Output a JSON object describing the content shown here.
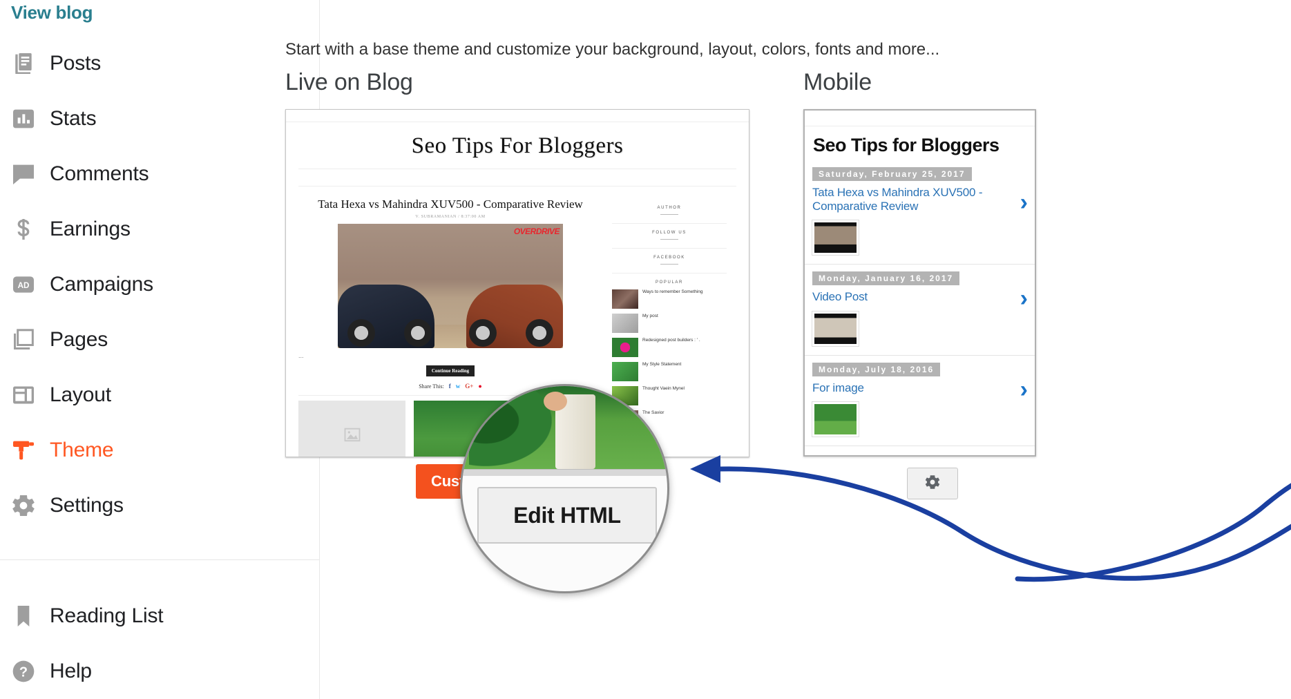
{
  "sidebar": {
    "view_blog": "View blog",
    "main_items": [
      {
        "label": "Posts",
        "icon": "posts-icon"
      },
      {
        "label": "Stats",
        "icon": "stats-icon"
      },
      {
        "label": "Comments",
        "icon": "comments-icon"
      },
      {
        "label": "Earnings",
        "icon": "earnings-icon"
      },
      {
        "label": "Campaigns",
        "icon": "campaigns-icon"
      },
      {
        "label": "Pages",
        "icon": "pages-icon"
      },
      {
        "label": "Layout",
        "icon": "layout-icon"
      },
      {
        "label": "Theme",
        "icon": "theme-icon"
      },
      {
        "label": "Settings",
        "icon": "settings-icon"
      }
    ],
    "bottom_items": [
      {
        "label": "Reading List",
        "icon": "bookmark-icon"
      },
      {
        "label": "Help",
        "icon": "help-icon"
      }
    ],
    "active_label": "Theme",
    "active_color": "#ff5722",
    "link_color": "#2a7f8f"
  },
  "main": {
    "description": "Start with a base theme and customize your background, layout, colors, fonts and more...",
    "live_title": "Live on Blog",
    "mobile_title": "Mobile",
    "customize_label": "Customize",
    "customize_color": "#f4511e",
    "edit_html_label": "Edit HTML",
    "gear_icon": "gear-icon"
  },
  "live_preview": {
    "blog_title": "Seo Tips For Bloggers",
    "post": {
      "title": "Tata Hexa vs Mahindra XUV500 - Comparative Review",
      "meta": "V. SUBRAMANIAN / 8:37:00 AM",
      "image_brand": "OVERDRIVE",
      "excerpt": "...",
      "continue_label": "Continue Reading",
      "share_label": "Share This:",
      "share_icons": [
        "facebook-icon",
        "twitter-icon",
        "google-plus-icon",
        "pinterest-icon"
      ]
    },
    "widgets": [
      {
        "label": "AUTHOR"
      },
      {
        "label": "FOLLOW US"
      },
      {
        "label": "FACEBOOK"
      }
    ],
    "popular_label": "POPULAR",
    "popular_posts": [
      {
        "text": "Ways to remember Something"
      },
      {
        "text": "My post"
      },
      {
        "text": "Redesigned post builders : ' ."
      },
      {
        "text": "My Style Statement"
      },
      {
        "text": "Thought Vaein Mynel"
      },
      {
        "text": "The Savior"
      }
    ]
  },
  "mobile_preview": {
    "blog_title": "Seo Tips for Bloggers",
    "posts": [
      {
        "date": "Saturday, February 25, 2017",
        "title": "Tata Hexa vs Mahindra XUV500 - Comparative Review",
        "chevron": "chevron-right-icon"
      },
      {
        "date": "Monday, January 16, 2017",
        "title": "Video Post",
        "chevron": "chevron-right-icon"
      },
      {
        "date": "Monday, July 18, 2016",
        "title": "For image",
        "chevron": "chevron-right-icon"
      }
    ]
  },
  "annotation": {
    "arrow_color": "#1a3fa0",
    "arrow_name": "blue-callout-arrow"
  }
}
